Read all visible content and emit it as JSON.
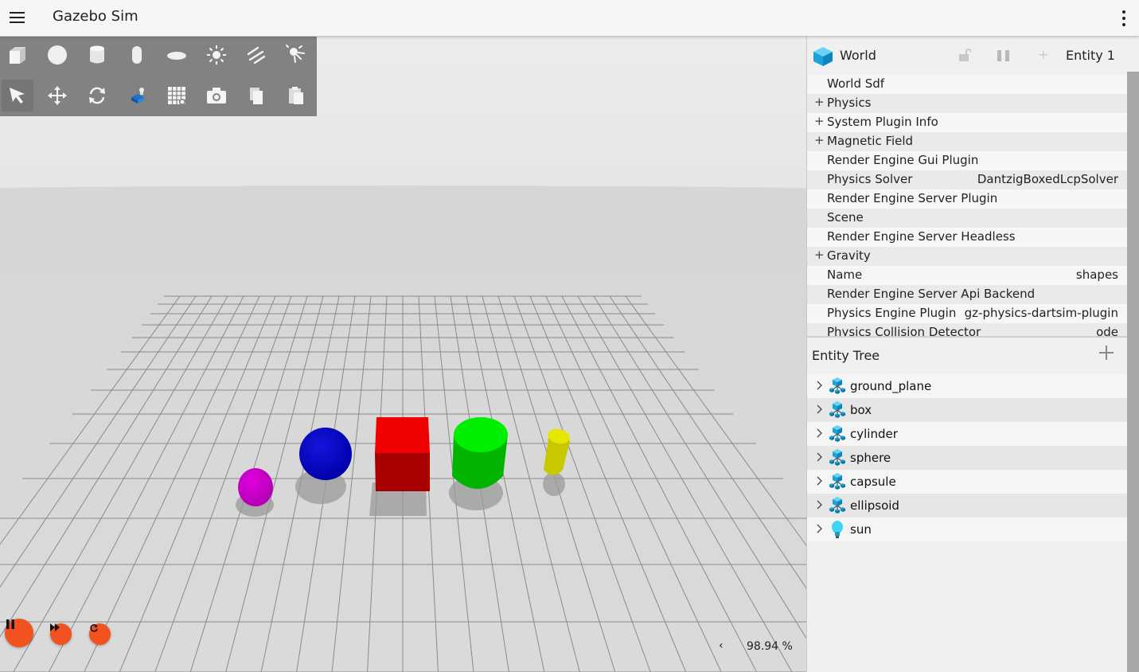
{
  "app": {
    "title": "Gazebo Sim",
    "menu_icon": "hamburger-menu-icon",
    "more_icon": "vertical-dots-icon"
  },
  "toolbar": {
    "row1": [
      {
        "name": "box-shape-tool",
        "icon": "box-icon"
      },
      {
        "name": "sphere-shape-tool",
        "icon": "sphere-icon"
      },
      {
        "name": "cylinder-shape-tool",
        "icon": "cylinder-icon"
      },
      {
        "name": "capsule-shape-tool",
        "icon": "capsule-icon"
      },
      {
        "name": "ellipsoid-shape-tool",
        "icon": "ellipsoid-icon"
      },
      {
        "name": "point-light-tool",
        "icon": "point-light-icon"
      },
      {
        "name": "directional-light-tool",
        "icon": "directional-light-icon"
      },
      {
        "name": "spot-light-tool",
        "icon": "spot-light-icon"
      }
    ],
    "row2": [
      {
        "name": "select-mode-tool",
        "icon": "cursor-arrow-icon"
      },
      {
        "name": "translate-mode-tool",
        "icon": "move-arrows-icon"
      },
      {
        "name": "rotate-mode-tool",
        "icon": "rotate-icon"
      },
      {
        "name": "transform-control-tool",
        "icon": "transform-control-icon"
      },
      {
        "name": "grid-config-tool",
        "icon": "grid-icon"
      },
      {
        "name": "screenshot-tool",
        "icon": "camera-icon"
      },
      {
        "name": "copy-tool",
        "icon": "copy-icon"
      },
      {
        "name": "paste-tool",
        "icon": "paste-icon"
      }
    ]
  },
  "playback": {
    "play_pause_icon": "pause-icon",
    "step_icon": "fast-forward-icon",
    "reset_icon": "reset-icon",
    "accent_color": "#f2521f"
  },
  "real_time_factor": {
    "collapse_arrow": "‹",
    "value": "98.94 %"
  },
  "scene": {
    "background_color": "#d3d3d3",
    "models": [
      {
        "name": "ellipsoid",
        "color": "#cc00cc"
      },
      {
        "name": "sphere",
        "color": "#0000cc"
      },
      {
        "name": "box",
        "color": "#ee0000"
      },
      {
        "name": "cylinder",
        "color": "#00cc00"
      },
      {
        "name": "capsule",
        "color": "#cccc00"
      }
    ]
  },
  "component_inspector": {
    "entity_name": "World",
    "entity_id_label": "Entity 1",
    "rows": [
      {
        "expandable": false,
        "name": "World Sdf",
        "value": ""
      },
      {
        "expandable": true,
        "name": "Physics",
        "value": ""
      },
      {
        "expandable": true,
        "name": "System Plugin Info",
        "value": ""
      },
      {
        "expandable": true,
        "name": "Magnetic Field",
        "value": ""
      },
      {
        "expandable": false,
        "name": "Render Engine Gui Plugin",
        "value": ""
      },
      {
        "expandable": false,
        "name": "Physics Solver",
        "value": "DantzigBoxedLcpSolver"
      },
      {
        "expandable": false,
        "name": "Render Engine Server Plugin",
        "value": ""
      },
      {
        "expandable": false,
        "name": "Scene",
        "value": ""
      },
      {
        "expandable": false,
        "name": "Render Engine Server Headless",
        "value": ""
      },
      {
        "expandable": true,
        "name": "Gravity",
        "value": ""
      },
      {
        "expandable": false,
        "name": "Name",
        "value": "shapes"
      },
      {
        "expandable": false,
        "name": "Render Engine Server Api Backend",
        "value": ""
      },
      {
        "expandable": false,
        "name": "Physics Engine Plugin",
        "value": "gz-physics-dartsim-plugin"
      },
      {
        "expandable": false,
        "name": "Physics Collision Detector",
        "value": "ode"
      }
    ],
    "expand_symbol": "+"
  },
  "entity_tree": {
    "title": "Entity Tree",
    "add_icon": "plus-icon",
    "items": [
      {
        "label": "ground_plane",
        "icon": "model-icon"
      },
      {
        "label": "box",
        "icon": "model-icon"
      },
      {
        "label": "cylinder",
        "icon": "model-icon"
      },
      {
        "label": "sphere",
        "icon": "model-icon"
      },
      {
        "label": "capsule",
        "icon": "model-icon"
      },
      {
        "label": "ellipsoid",
        "icon": "model-icon"
      },
      {
        "label": "sun",
        "icon": "light-bulb-icon"
      }
    ]
  }
}
